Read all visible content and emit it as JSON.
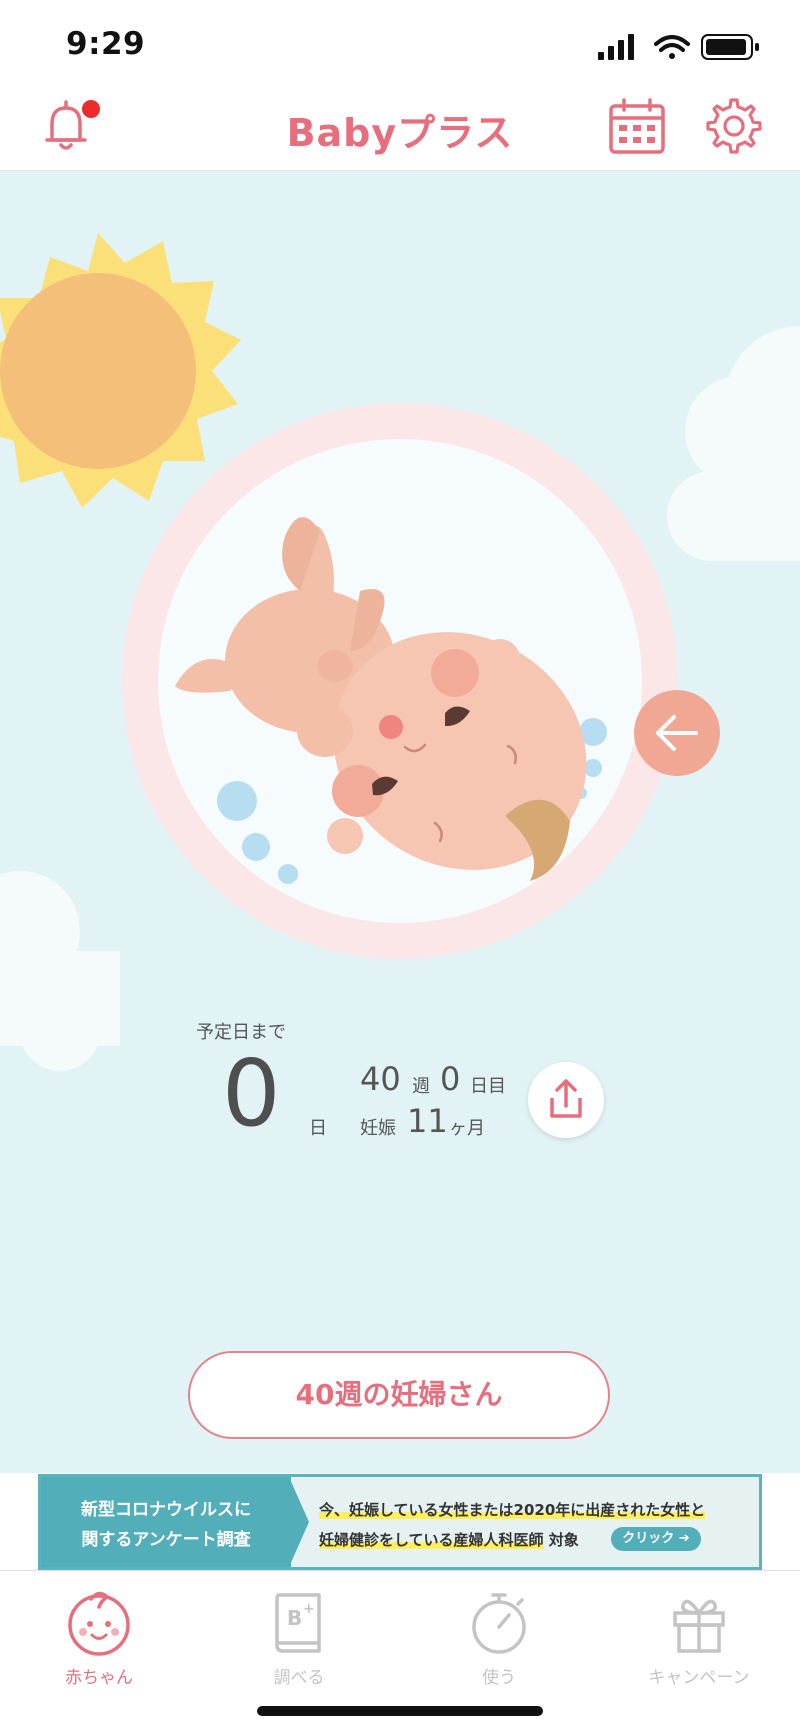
{
  "status_bar": {
    "time": "9:29"
  },
  "header": {
    "title": "Babyプラス"
  },
  "countdown": {
    "label": "予定日まで",
    "days": "0",
    "days_unit": "日",
    "week": "40",
    "week_unit": "週",
    "day": "0",
    "day_unit": "日目",
    "pregnancy_label": "妊娠",
    "month": "11",
    "month_unit": "ヶ月"
  },
  "stage_button": {
    "label": "40週の妊婦さん"
  },
  "banner": {
    "title_line1": "新型コロナウイルスに",
    "title_line2": "関するアンケート調査",
    "line1": "今、妊娠している女性または2020年に出産された女性と",
    "line2_highlight": "妊婦健診をしている産婦人科医師",
    "line2_suffix": " 対象",
    "click_label": "クリック ➔"
  },
  "tabs": [
    {
      "label": "赤ちゃん",
      "icon": "baby-face-icon",
      "active": true
    },
    {
      "label": "調べる",
      "icon": "book-icon",
      "active": false
    },
    {
      "label": "使う",
      "icon": "stopwatch-icon",
      "active": false
    },
    {
      "label": "キャンペーン",
      "icon": "gift-icon",
      "active": false
    }
  ],
  "colors": {
    "accent": "#e76f7d",
    "scene_background": "#e2f3f6",
    "banner_teal": "#52aeb8"
  }
}
